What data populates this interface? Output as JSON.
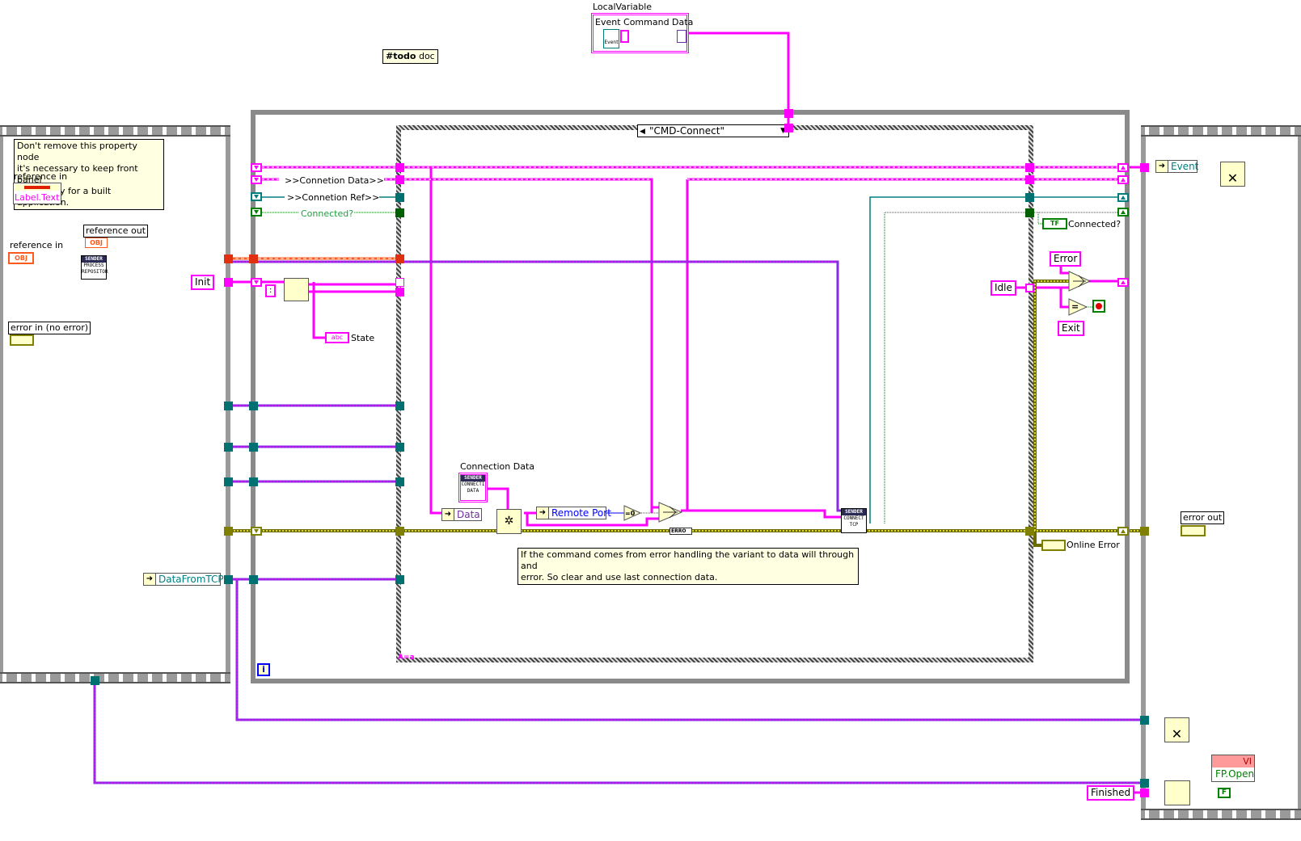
{
  "diagram": {
    "type": "LabVIEW block diagram",
    "todo_note": {
      "hash": "#todo",
      "text": "doc"
    },
    "local_variable": {
      "caption": "LocalVariable",
      "name": "Event Command Data",
      "event_icon_label": "Event"
    },
    "left_frame": {
      "comment": "Don't remove this property node it's necessary to keep front panel in memory for a built application.",
      "comment_lines": [
        "Don't remove this property node",
        "it's necessary to keep front panel",
        "in memory for a built application."
      ],
      "property_node": {
        "ref_label": "reference in",
        "property": "Label.Text"
      },
      "reference_in": {
        "label": "reference in",
        "terminal": "OBJ"
      },
      "reference_out": {
        "label": "reference out",
        "terminal": "OBJ"
      },
      "error_in": {
        "label": "error in (no error)"
      },
      "subvi": {
        "header": "SENDER",
        "line1": "PROCESS",
        "line2": "REPOSITOR"
      },
      "init_constant": "Init",
      "data_from_tcp": "DataFromTCP"
    },
    "while_loop": {
      "shift_registers": [
        {
          "label": ""
        },
        {
          "label": ">>Connetion Data>>"
        },
        {
          "label": ">>Connetion Ref>>"
        },
        {
          "label": "Connected?"
        }
      ],
      "colon_constant": ":",
      "state_indicator": {
        "label": "State",
        "terminal": "abc"
      },
      "iteration_terminal": "i"
    },
    "case_structure": {
      "selector_value": "\"CMD-Connect\"",
      "corner_label": "A=a",
      "connection_data_constant": {
        "label": "Connection Data",
        "header": "SENDER",
        "line1": "CONNECTI",
        "line2": "DATA"
      },
      "unbundle_data": "Data",
      "unbundle_remote_port": "Remote Port",
      "equal_zero": "=0",
      "error_tag": "ERRO",
      "connect_subvi": {
        "header": "SENDER",
        "line1": "CONNECT",
        "line2": "TCP"
      },
      "comment": "If the command comes from error handling the variant to data will through and error. So clear and use last connection data.",
      "comment_lines": [
        "If the command comes from error handling the variant to data will through and",
        "error. So clear and use last connection data."
      ]
    },
    "right_loop_area": {
      "connected_indicator": {
        "label": "Connected?",
        "terminal": "TF"
      },
      "idle_constant": "Idle",
      "error_constant": "Error",
      "exit_constant": "Exit",
      "equal_label": "=",
      "online_error_label": "Online Error"
    },
    "right_frame": {
      "unbundle_event": "Event",
      "error_out": {
        "label": "error out"
      },
      "finished_constant": "Finished",
      "property_node": {
        "class": "VI",
        "property": "FP.Open",
        "value_constant": "F"
      }
    },
    "colors": {
      "string_wire": "#ff00ff",
      "refnum_wire": "#ff5a1e",
      "cluster_wire": "#007e7e",
      "class_wire": "#7030a0",
      "error_wire": "#c8c800",
      "boolean_wire": "#008000",
      "numeric_wire": "#0000ff"
    }
  }
}
